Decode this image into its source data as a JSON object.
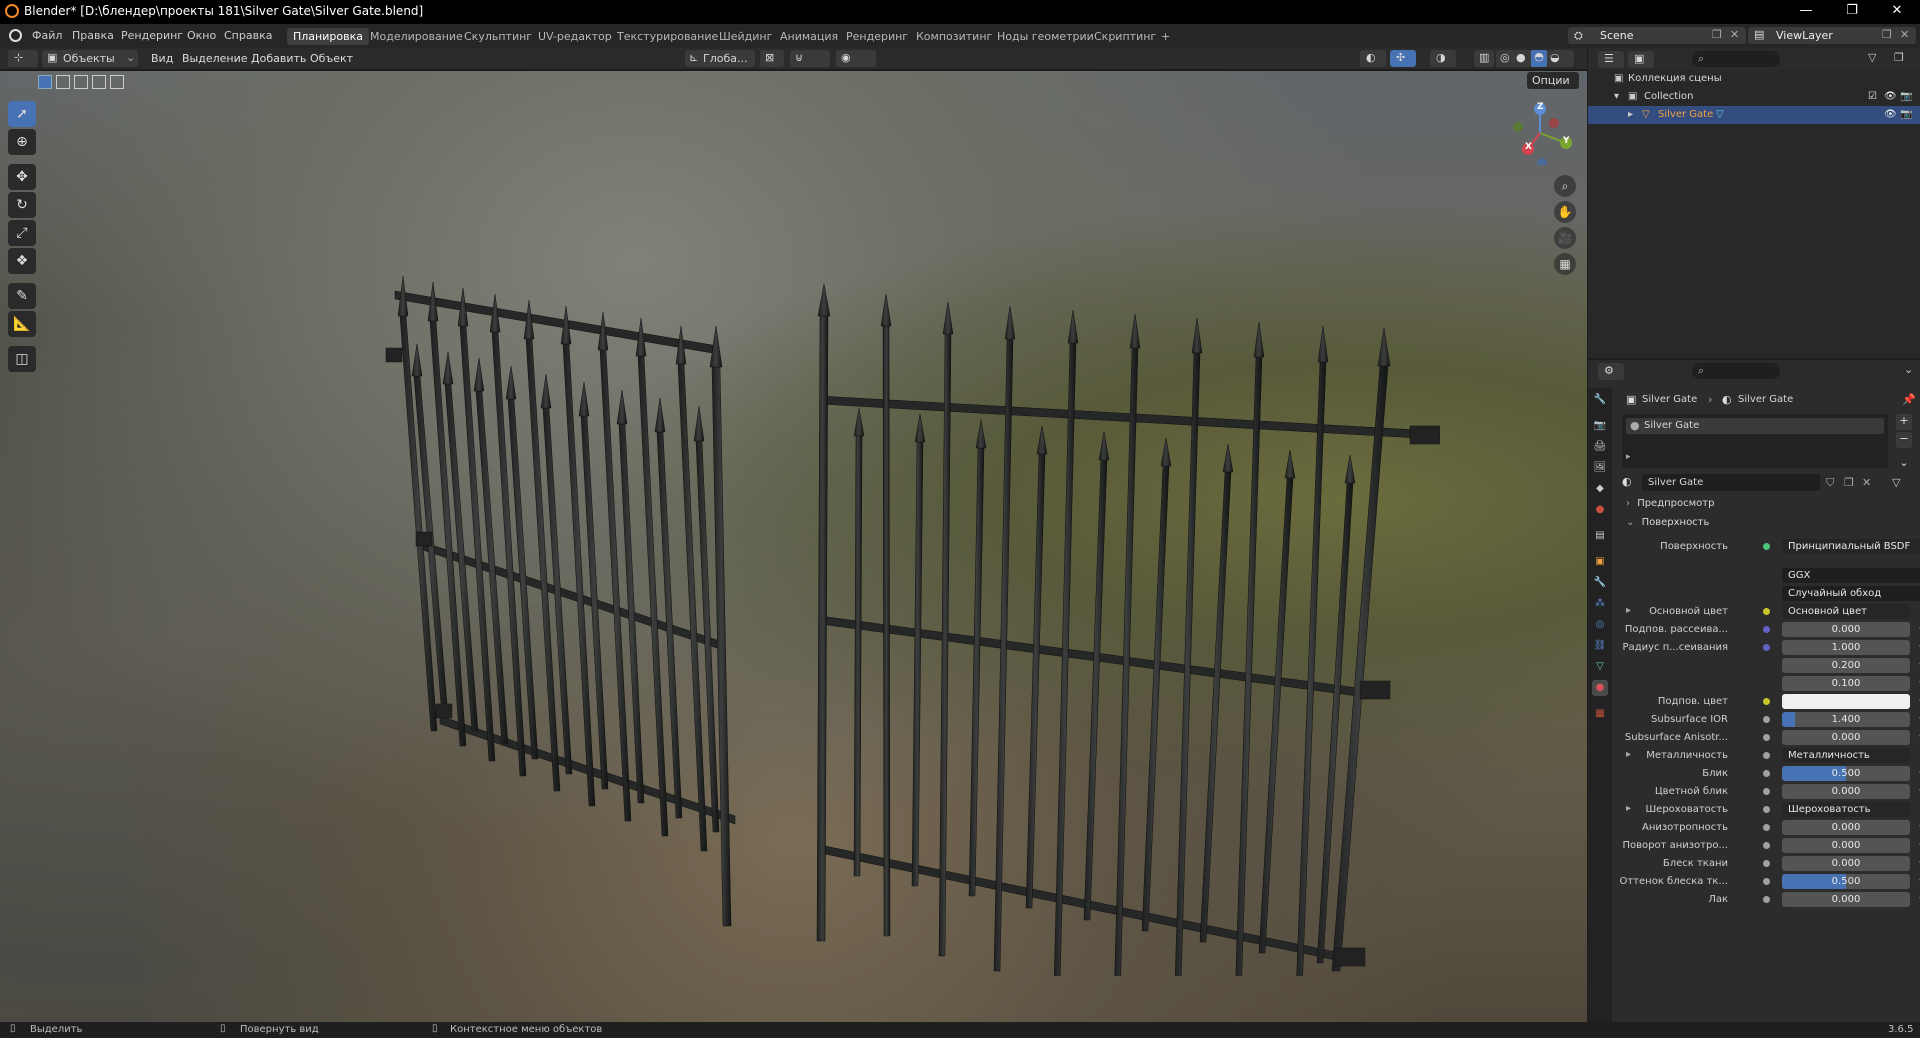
{
  "titlebar": {
    "title": "Blender* [D:\\блендер\\проекты 181\\Silver Gate\\Silver Gate.blend]",
    "minimize": "—",
    "restore": "❐",
    "close": "✕"
  },
  "menu": [
    "Файл",
    "Правка",
    "Рендеринг",
    "Окно",
    "Справка"
  ],
  "workspaces": [
    "Планировка",
    "Моделирование",
    "Скульптинг",
    "UV-редактор",
    "Текстурирование",
    "Шейдинг",
    "Анимация",
    "Рендеринг",
    "Композитинг",
    "Ноды геометрии",
    "Скриптинг"
  ],
  "add_workspace": "+",
  "scene": {
    "label": "Scene",
    "viewlayer": "ViewLayer"
  },
  "viewport_header": {
    "mode": "Объекты",
    "menus": [
      "Вид",
      "Выделение",
      "Добавить",
      "Объект"
    ],
    "orientation": "Глоба...",
    "options": "Опции"
  },
  "gizmo": {
    "x": "X",
    "y": "Y",
    "z": "Z"
  },
  "outliner": {
    "scene_collection": "Коллекция сцены",
    "collection": "Collection",
    "object": "Silver Gate"
  },
  "properties": {
    "breadcrumb_object": "Silver Gate",
    "breadcrumb_material": "Silver Gate",
    "slot": "Silver Gate",
    "material_name": "Silver Gate",
    "section_preview": "Предпросмотр",
    "section_surface": "Поверхность",
    "surface_label": "Поверхность",
    "surface_value": "Принципиальный BSDF",
    "distribution": "GGX",
    "subsurface_method": "Случайный обход",
    "rows": [
      {
        "label": "Основной цвет",
        "value": "Основной цвет",
        "kind": "link",
        "dot": "#c7c729",
        "expand": true
      },
      {
        "label": "Подпов. рассеива...",
        "value": "0.000",
        "kind": "num",
        "dot": "#6363c7",
        "fill": 0
      },
      {
        "label": "Радиус п...сеивания",
        "value": "1.000",
        "kind": "num",
        "dot": "#6363c7",
        "fill": 0
      },
      {
        "label": "",
        "value": "0.200",
        "kind": "num",
        "dot": "",
        "fill": 0
      },
      {
        "label": "",
        "value": "0.100",
        "kind": "num",
        "dot": "",
        "fill": 0
      },
      {
        "label": "Подпов. цвет",
        "value": "",
        "kind": "color",
        "dot": "#c7c729"
      },
      {
        "label": "Subsurface IOR",
        "value": "1.400",
        "kind": "num",
        "dot": "#a1a1a1",
        "fill": 0.1
      },
      {
        "label": "Subsurface Anisotr...",
        "value": "0.000",
        "kind": "num",
        "dot": "#a1a1a1",
        "fill": 0
      },
      {
        "label": "Металличность",
        "value": "Металличность",
        "kind": "link",
        "dot": "#a1a1a1",
        "expand": true
      },
      {
        "label": "Блик",
        "value": "0.500",
        "kind": "num",
        "dot": "#a1a1a1",
        "fill": 0.5
      },
      {
        "label": "Цветной блик",
        "value": "0.000",
        "kind": "num",
        "dot": "#a1a1a1",
        "fill": 0
      },
      {
        "label": "Шероховатость",
        "value": "Шероховатость",
        "kind": "link",
        "dot": "#a1a1a1",
        "expand": true
      },
      {
        "label": "Анизотропность",
        "value": "0.000",
        "kind": "num",
        "dot": "#a1a1a1",
        "fill": 0
      },
      {
        "label": "Поворот анизотро...",
        "value": "0.000",
        "kind": "num",
        "dot": "#a1a1a1",
        "fill": 0
      },
      {
        "label": "Блеск ткани",
        "value": "0.000",
        "kind": "num",
        "dot": "#a1a1a1",
        "fill": 0
      },
      {
        "label": "Оттенок блеска тк...",
        "value": "0.500",
        "kind": "num",
        "dot": "#a1a1a1",
        "fill": 0.5
      },
      {
        "label": "Лак",
        "value": "0.000",
        "kind": "num",
        "dot": "#a1a1a1",
        "fill": 0
      }
    ]
  },
  "status": {
    "select": "Выделить",
    "rotate": "Повернуть вид",
    "context": "Контекстное меню объектов",
    "version": "3.6.5"
  },
  "colors": {
    "accent": "#4772b3",
    "selected_row": "#334d80",
    "object_orange": "#f0a040"
  }
}
